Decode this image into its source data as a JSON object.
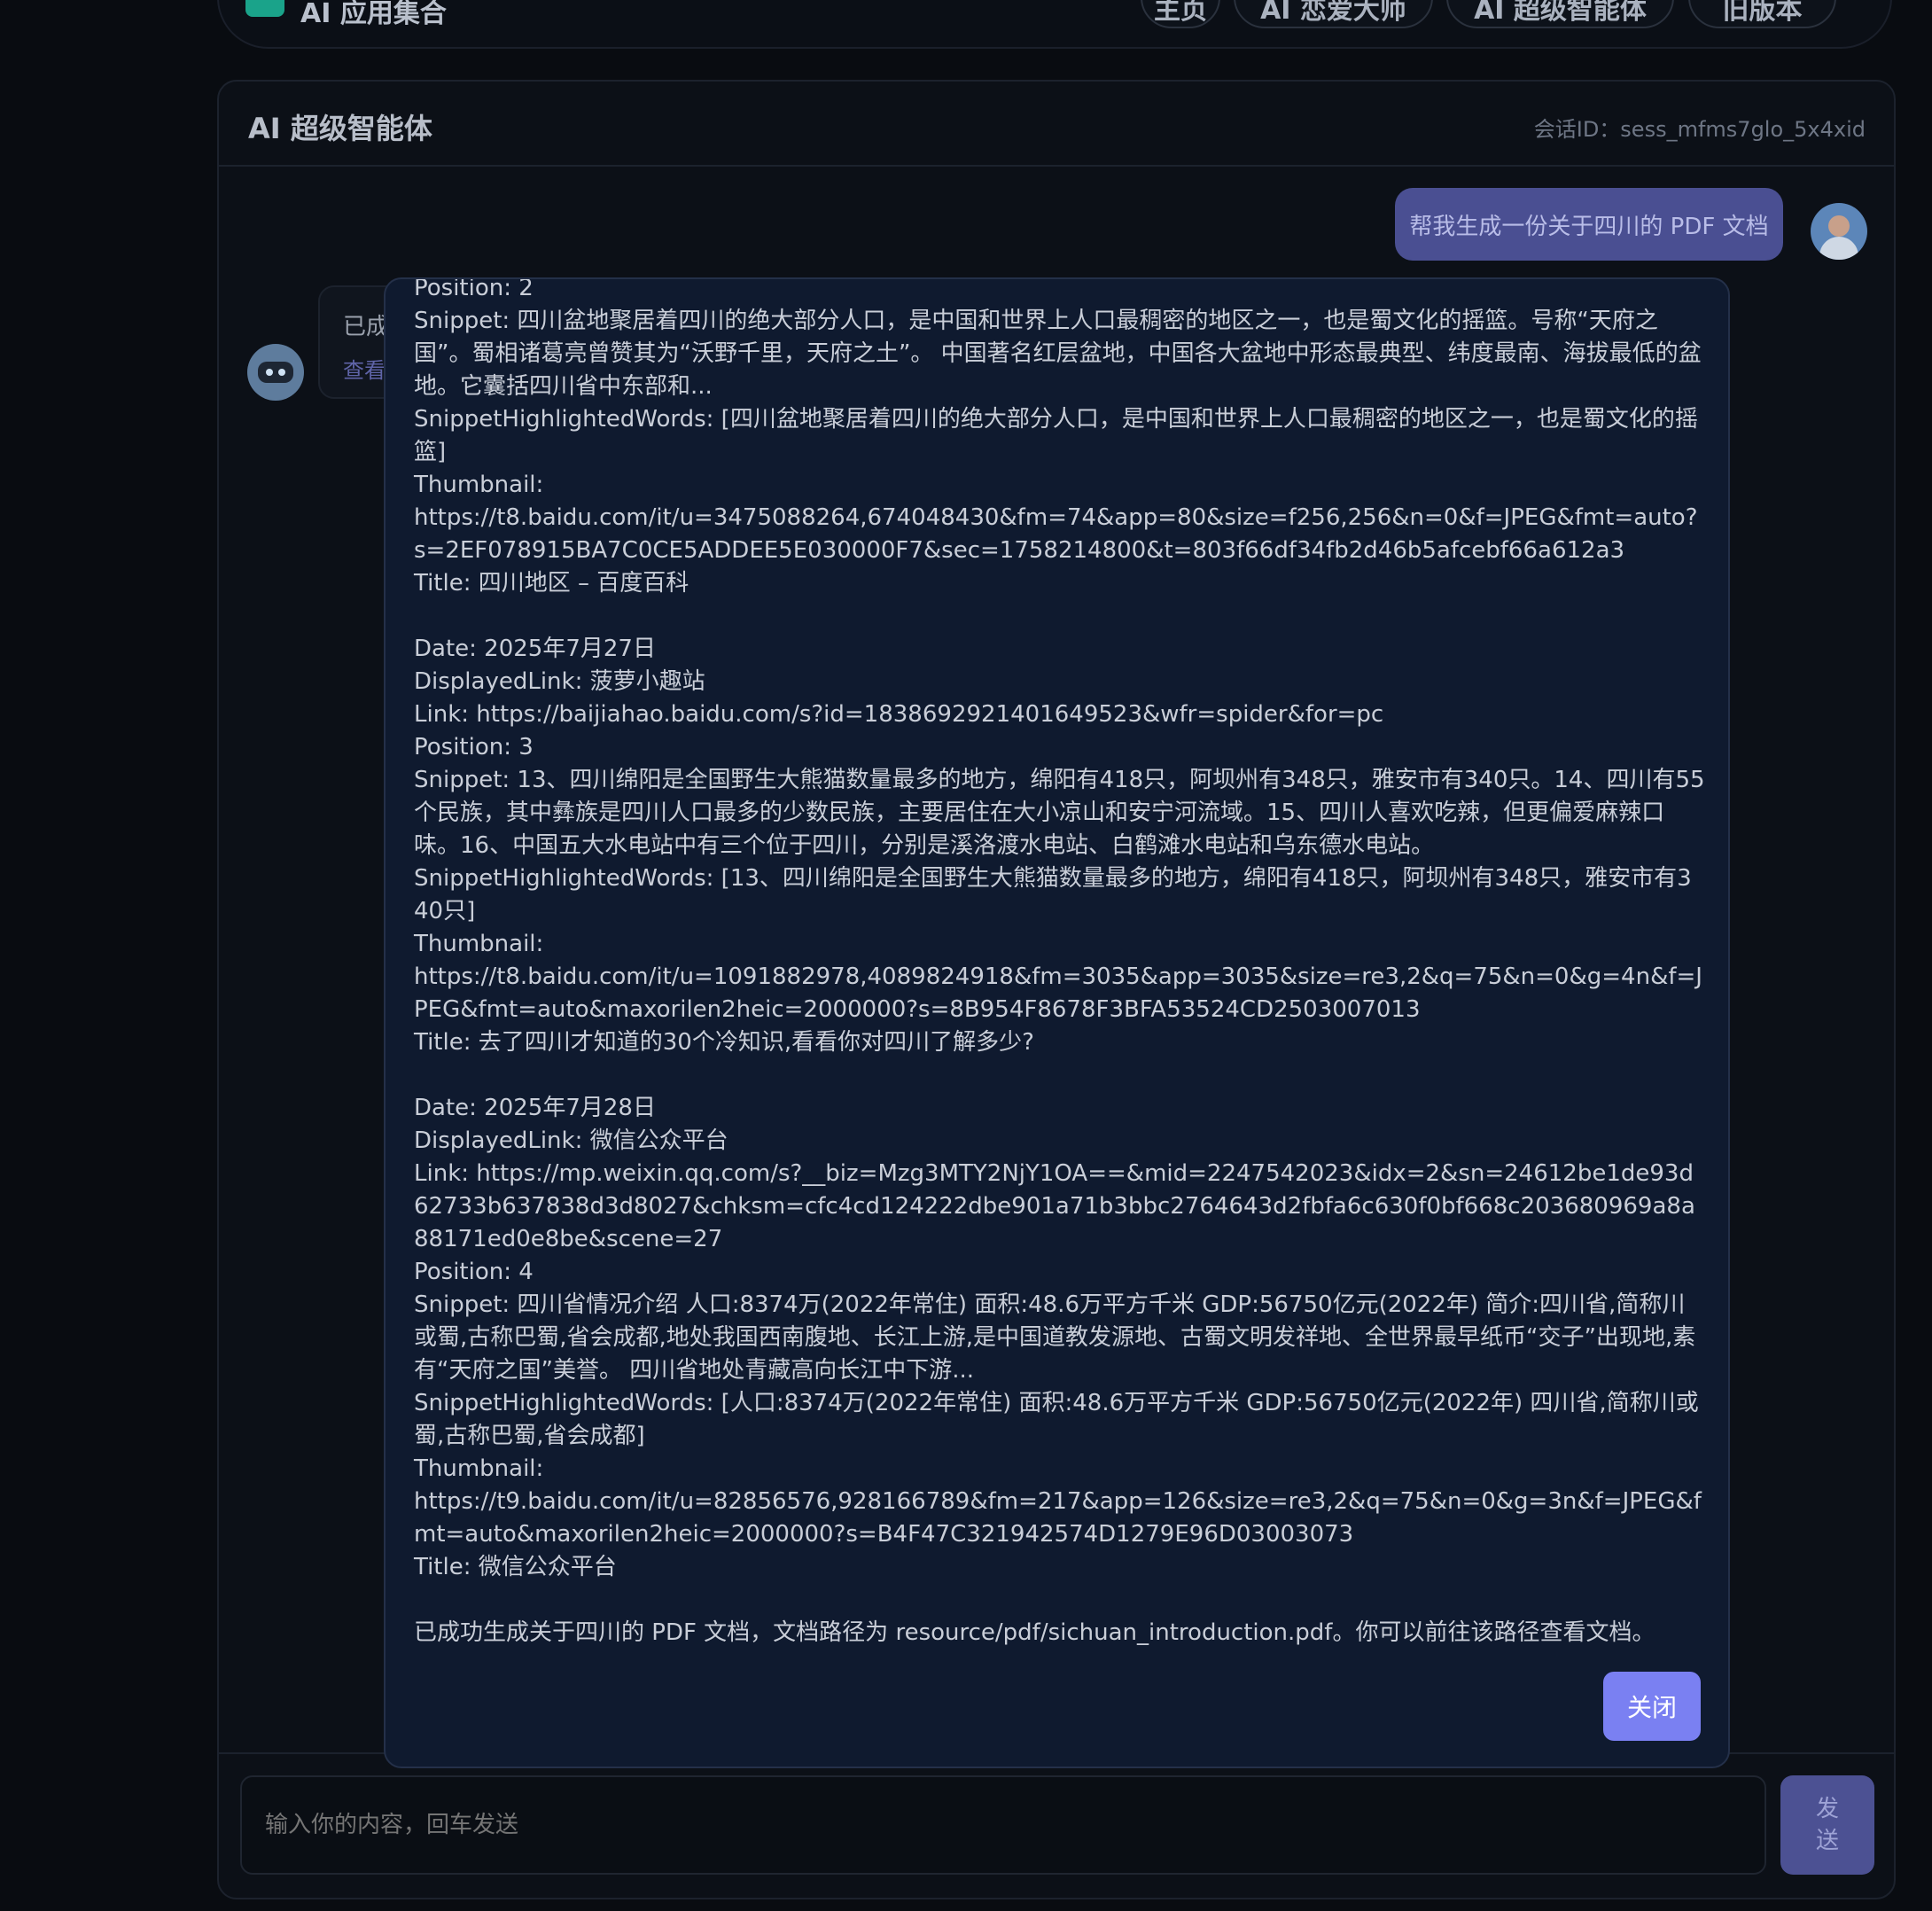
{
  "nav": {
    "title": "AI 应用集合",
    "items": [
      "主页",
      "AI 恋爱大师",
      "AI 超级智能体",
      "旧版本"
    ]
  },
  "panel": {
    "title": "AI 超级智能体",
    "session_id": "会话ID：sess_mfms7glo_5x4xid"
  },
  "messages": {
    "user": "帮我生成一份关于四川的 PDF 文档",
    "bot_preview": "已成",
    "bot_link": "查看"
  },
  "modal": {
    "content": "Position: 2\nSnippet: 四川盆地聚居着四川的绝大部分人口，是中国和世界上人口最稠密的地区之一，也是蜀文化的摇篮。号称“天府之国”。蜀相诸葛亮曾赞其为“沃野千里，天府之土”。 中国著名红层盆地，中国各大盆地中形态最典型、纬度最南、海拔最低的盆地。它囊括四川省中东部和...\nSnippetHighlightedWords: [四川盆地聚居着四川的绝大部分人口，是中国和世界上人口最稠密的地区之一，也是蜀文化的摇篮]\nThumbnail:\nhttps://t8.baidu.com/it/u=3475088264,674048430&fm=74&app=80&size=f256,256&n=0&f=JPEG&fmt=auto?s=2EF078915BA7C0CE5ADDEE5E030000F7&sec=1758214800&t=803f66df34fb2d46b5afcebf66a612a3\nTitle: 四川地区 – 百度百科\n\nDate: 2025年7月27日\nDisplayedLink: 菠萝小趣站\nLink: https://baijiahao.baidu.com/s?id=1838692921401649523&wfr=spider&for=pc\nPosition: 3\nSnippet: 13、四川绵阳是全国野生大熊猫数量最多的地方，绵阳有418只，阿坝州有348只，雅安市有340只。14、四川有55个民族，其中彝族是四川人口最多的少数民族，主要居住在大小凉山和安宁河流域。15、四川人喜欢吃辣，但更偏爱麻辣口味。16、中国五大水电站中有三个位于四川，分别是溪洛渡水电站、白鹤滩水电站和乌东德水电站。\nSnippetHighlightedWords: [13、四川绵阳是全国野生大熊猫数量最多的地方，绵阳有418只，阿坝州有348只，雅安市有340只]\nThumbnail:\nhttps://t8.baidu.com/it/u=1091882978,4089824918&fm=3035&app=3035&size=re3,2&q=75&n=0&g=4n&f=JPEG&fmt=auto&maxorilen2heic=2000000?s=8B954F8678F3BFA53524CD2503007013\nTitle: 去了四川才知道的30个冷知识,看看你对四川了解多少?\n\nDate: 2025年7月28日\nDisplayedLink: 微信公众平台\nLink: https://mp.weixin.qq.com/s?__biz=Mzg3MTY2NjY1OA==&mid=2247542023&idx=2&sn=24612be1de93d62733b637838d3d8027&chksm=cfc4cd124222dbe901a71b3bbc2764643d2fbfa6c630f0bf668c203680969a8a88171ed0e8be&scene=27\nPosition: 4\nSnippet: 四川省情况介绍 人口:8374万(2022年常住) 面积:48.6万平方千米 GDP:56750亿元(2022年) 简介:四川省,简称川或蜀,古称巴蜀,省会成都,地处我国西南腹地、长江上游,是中国道教发源地、古蜀文明发祥地、全世界最早纸币“交子”出现地,素有“天府之国”美誉。 四川省地处青藏高向长江中下游...\nSnippetHighlightedWords: [人口:8374万(2022年常住) 面积:48.6万平方千米 GDP:56750亿元(2022年) 四川省,简称川或蜀,古称巴蜀,省会成都]\nThumbnail:\nhttps://t9.baidu.com/it/u=82856576,928166789&fm=217&app=126&size=re3,2&q=75&n=0&g=3n&f=JPEG&fmt=auto&maxorilen2heic=2000000?s=B4F47C321942574D1279E96D03003073\nTitle: 微信公众平台\n\n已成功生成关于四川的 PDF 文档，文档路径为 resource/pdf/sichuan_introduction.pdf。你可以前往该路径查看文档。",
    "close_label": "关闭"
  },
  "input": {
    "placeholder": "输入你的内容，回车发送",
    "send_line1": "发",
    "send_line2": "送"
  },
  "colors": {
    "accent": "#7a80f2",
    "user_bubble": "#4a4f92",
    "modal_bg": "#0f1a2f"
  }
}
